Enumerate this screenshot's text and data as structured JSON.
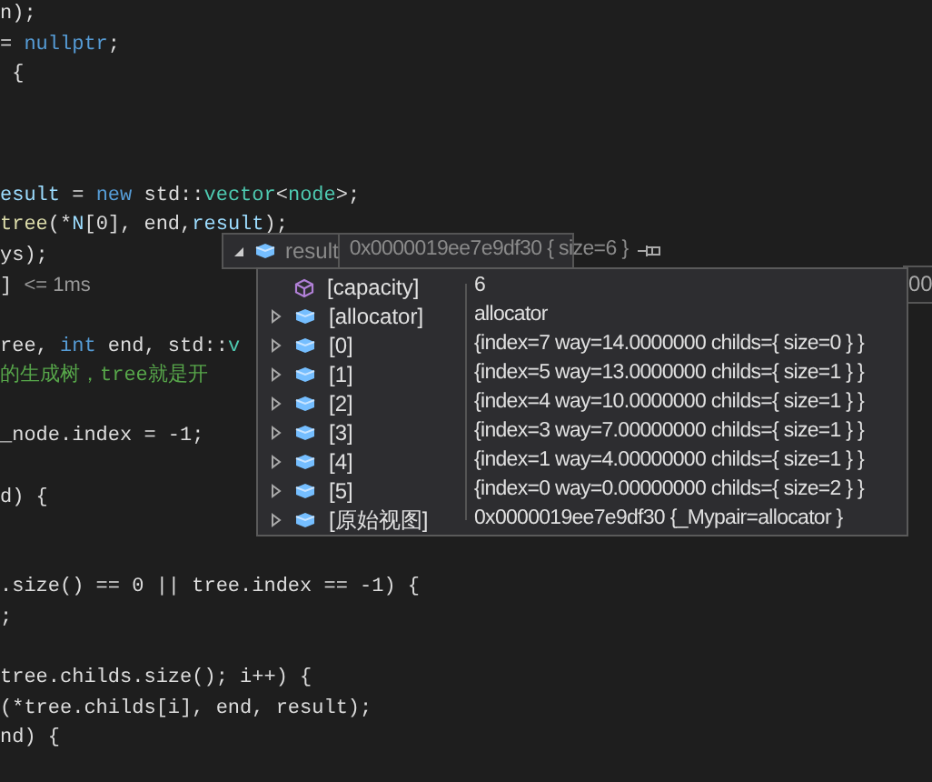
{
  "editor": {
    "lines": [
      {
        "kind": "code",
        "segments": [
          {
            "text": "n);",
            "kind": "plain"
          }
        ]
      },
      {
        "kind": "code",
        "segments": [
          {
            "text": "= ",
            "kind": "plain"
          },
          {
            "text": "nullptr",
            "kind": "keyword"
          },
          {
            "text": ";",
            "kind": "plain"
          }
        ]
      },
      {
        "kind": "code",
        "segments": [
          {
            "text": " {",
            "kind": "plain"
          }
        ]
      },
      {
        "kind": "blank"
      },
      {
        "kind": "blank"
      },
      {
        "kind": "blank"
      },
      {
        "kind": "code",
        "segments": [
          {
            "text": "esult",
            "kind": "variable"
          },
          {
            "text": " = ",
            "kind": "plain"
          },
          {
            "text": "new",
            "kind": "keyword"
          },
          {
            "text": " std::",
            "kind": "plain"
          },
          {
            "text": "vector",
            "kind": "type"
          },
          {
            "text": "<",
            "kind": "plain"
          },
          {
            "text": "node",
            "kind": "type"
          },
          {
            "text": ">;",
            "kind": "plain"
          }
        ]
      },
      {
        "kind": "code",
        "segments": [
          {
            "text": "tree",
            "kind": "function"
          },
          {
            "text": "(*",
            "kind": "plain"
          },
          {
            "text": "N",
            "kind": "variable"
          },
          {
            "text": "[0], end,",
            "kind": "plain"
          },
          {
            "text": "result",
            "kind": "variable"
          },
          {
            "text": ");",
            "kind": "plain"
          }
        ]
      },
      {
        "kind": "code",
        "segments": [
          {
            "text": "ys);",
            "kind": "plain"
          }
        ]
      },
      {
        "kind": "code",
        "segments": [
          {
            "text": "] ",
            "kind": "plain"
          },
          {
            "text": "<= 1ms",
            "kind": "perf"
          }
        ]
      },
      {
        "kind": "blank"
      },
      {
        "kind": "code",
        "segments": [
          {
            "text": "ree, ",
            "kind": "plain"
          },
          {
            "text": "int",
            "kind": "keyword"
          },
          {
            "text": " end, std::",
            "kind": "plain"
          },
          {
            "text": "v",
            "kind": "type"
          }
        ]
      },
      {
        "kind": "code",
        "segments": [
          {
            "text": "的生成树，tree就是开",
            "kind": "comment"
          }
        ]
      },
      {
        "kind": "blank"
      },
      {
        "kind": "code",
        "segments": [
          {
            "text": "_node.index = -1;",
            "kind": "plain"
          }
        ]
      },
      {
        "kind": "blank"
      },
      {
        "kind": "code",
        "segments": [
          {
            "text": "d) {",
            "kind": "plain"
          }
        ]
      },
      {
        "kind": "blank"
      },
      {
        "kind": "blank"
      },
      {
        "kind": "code",
        "segments": [
          {
            "text": ".size() == 0 || tree.index == -1) {",
            "kind": "plain"
          }
        ]
      },
      {
        "kind": "code",
        "segments": [
          {
            "text": ";",
            "kind": "plain"
          }
        ]
      },
      {
        "kind": "blank"
      },
      {
        "kind": "code",
        "segments": [
          {
            "text": "tree.childs.size(); i++) {",
            "kind": "plain"
          }
        ]
      },
      {
        "kind": "code",
        "segments": [
          {
            "text": "(*tree.childs[i], end, result);",
            "kind": "plain"
          }
        ]
      },
      {
        "kind": "code",
        "segments": [
          {
            "text": "nd) {",
            "kind": "plain"
          }
        ]
      }
    ]
  },
  "datatip": {
    "name": "result",
    "value": "0x0000019ee7e9df30 { size=6 }",
    "expanded": true,
    "items": [
      {
        "name": "[capacity]",
        "value": "6",
        "kind": "property",
        "expandable": false
      },
      {
        "name": "[allocator]",
        "value": "allocator",
        "kind": "field",
        "expandable": true
      },
      {
        "name": "[0]",
        "value": "{index=7 way=14.0000000 childs={ size=0 } }",
        "kind": "field",
        "expandable": true
      },
      {
        "name": "[1]",
        "value": "{index=5 way=13.0000000 childs={ size=1 } }",
        "kind": "field",
        "expandable": true
      },
      {
        "name": "[2]",
        "value": "{index=4 way=10.0000000 childs={ size=1 } }",
        "kind": "field",
        "expandable": true
      },
      {
        "name": "[3]",
        "value": "{index=3 way=7.00000000 childs={ size=1 } }",
        "kind": "field",
        "expandable": true
      },
      {
        "name": "[4]",
        "value": "{index=1 way=4.00000000 childs={ size=1 } }",
        "kind": "field",
        "expandable": true
      },
      {
        "name": "[5]",
        "value": "{index=0 way=0.00000000 childs={ size=2 } }",
        "kind": "field",
        "expandable": true
      },
      {
        "name": "[原始视图]",
        "value": "0x0000019ee7e9df30 {_Mypair=allocator }",
        "kind": "field",
        "expandable": true
      }
    ]
  },
  "other_tip": {
    "text": "00"
  }
}
